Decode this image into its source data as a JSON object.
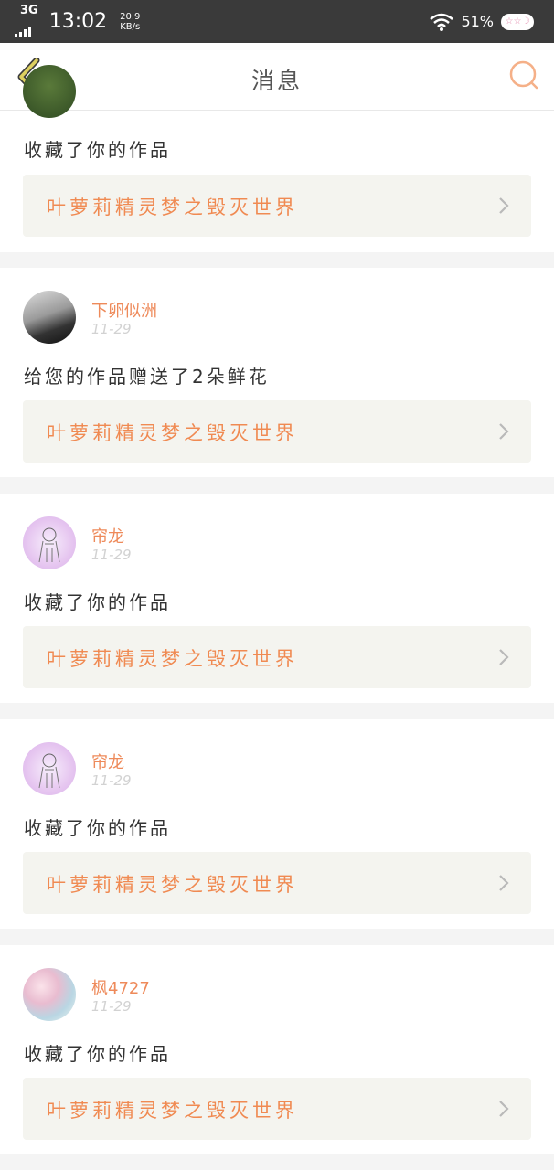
{
  "status_bar": {
    "network": "3G",
    "time": "13:02",
    "speed_value": "20.9",
    "speed_unit": "KB/s",
    "battery_pct": "51%",
    "battery_icon": "☆☆☽"
  },
  "header": {
    "title": "消息",
    "back_icon": "chevron-left-icon",
    "search_icon": "search-icon"
  },
  "colors": {
    "accent": "#f08a52",
    "back_arrow": "#ddd060",
    "card_bg": "#f4f4ef"
  },
  "messages": [
    {
      "user": "",
      "date": "",
      "text": "收藏了你的作品",
      "work": "叶萝莉精灵梦之毁灭世界"
    },
    {
      "user": "下卵似洲",
      "date": "11-29",
      "text": "给您的作品赠送了2朵鲜花",
      "work": "叶萝莉精灵梦之毁灭世界"
    },
    {
      "user": "帘龙",
      "date": "11-29",
      "text": "收藏了你的作品",
      "work": "叶萝莉精灵梦之毁灭世界"
    },
    {
      "user": "帘龙",
      "date": "11-29",
      "text": "收藏了你的作品",
      "work": "叶萝莉精灵梦之毁灭世界"
    },
    {
      "user": "枫4727",
      "date": "11-29",
      "text": "收藏了你的作品",
      "work": "叶萝莉精灵梦之毁灭世界"
    }
  ]
}
